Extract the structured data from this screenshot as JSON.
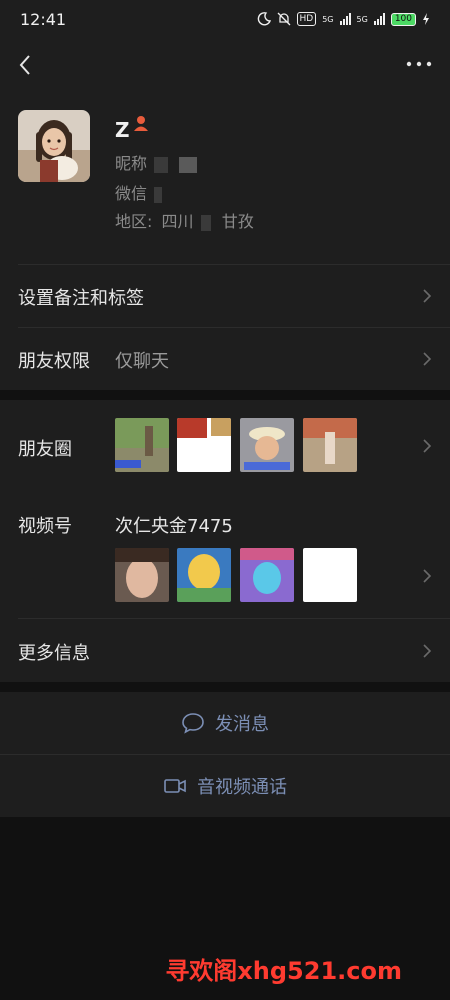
{
  "status": {
    "time": "12:41",
    "hd": "HD",
    "net1": "5G",
    "net2": "5G",
    "battery": "100"
  },
  "profile": {
    "name": "Z",
    "nickname_label": "昵称",
    "wechat_label": "微信",
    "region_label": "地区:",
    "region_value1": "四川",
    "region_value2": "甘孜"
  },
  "rows": {
    "tags_label": "设置备注和标签",
    "permission_label": "朋友权限",
    "permission_value": "仅聊天",
    "moments_label": "朋友圈",
    "channels_label": "视频号",
    "channels_value": "次仁央金7475",
    "more_label": "更多信息"
  },
  "actions": {
    "message_label": "发消息",
    "call_label": "音视频通话"
  },
  "watermark": "寻欢阁xhg521.com",
  "colors": {
    "background": "#111111",
    "card": "#1e1e1e",
    "link_blue": "#7c8fb5",
    "watermark_red": "#ff3b30"
  }
}
